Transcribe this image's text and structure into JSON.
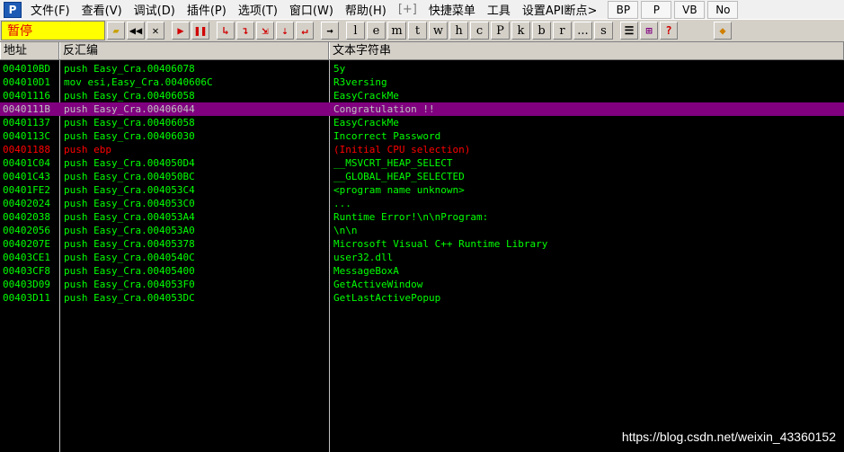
{
  "menubar": {
    "app_icon": "P",
    "items": [
      "文件(F)",
      "查看(V)",
      "调试(D)",
      "插件(P)",
      "选项(T)",
      "窗口(W)",
      "帮助(H)",
      "[+]",
      "快捷菜单",
      "工具",
      "设置API断点>"
    ],
    "tabs": [
      "BP",
      "P",
      "VB",
      "No"
    ]
  },
  "toolbar": {
    "status": "暂停",
    "letters": [
      "l",
      "e",
      "m",
      "t",
      "w",
      "h",
      "c",
      "P",
      "k",
      "b",
      "r",
      "...",
      "s"
    ],
    "icons": [
      "open-icon",
      "rewind-icon",
      "close-icon",
      "run-icon",
      "pause-icon",
      "step-into-icon",
      "step-over-icon",
      "trace-into-icon",
      "trace-over-icon",
      "execute-till-return-icon",
      "go-to-icon",
      "list-icon",
      "grid-icon",
      "help-icon",
      "plugin-icon"
    ]
  },
  "columns": {
    "addr": "地址",
    "disasm": "反汇编",
    "text": "文本字符串"
  },
  "rows": [
    {
      "addr": "004010BD",
      "disasm": "push Easy_Cra.00406078",
      "text": "5y"
    },
    {
      "addr": "004010D1",
      "disasm": "mov esi,Easy_Cra.0040606C",
      "text": "R3versing"
    },
    {
      "addr": "00401116",
      "disasm": "push Easy_Cra.00406058",
      "text": "EasyCrackMe"
    },
    {
      "addr": "0040111B",
      "disasm": "push Easy_Cra.00406044",
      "text": "Congratulation !!",
      "style": "sel"
    },
    {
      "addr": "00401137",
      "disasm": "push Easy_Cra.00406058",
      "text": "EasyCrackMe"
    },
    {
      "addr": "0040113C",
      "disasm": "push Easy_Cra.00406030",
      "text": "Incorrect Password"
    },
    {
      "addr": "00401188",
      "disasm": "push ebp",
      "text": "(Initial CPU selection)",
      "style": "red"
    },
    {
      "addr": "00401C04",
      "disasm": "push Easy_Cra.004050D4",
      "text": "__MSVCRT_HEAP_SELECT"
    },
    {
      "addr": "00401C43",
      "disasm": "push Easy_Cra.004050BC",
      "text": "__GLOBAL_HEAP_SELECTED"
    },
    {
      "addr": "00401FE2",
      "disasm": "push Easy_Cra.004053C4",
      "text": "<program name unknown>"
    },
    {
      "addr": "00402024",
      "disasm": "push Easy_Cra.004053C0",
      "text": "..."
    },
    {
      "addr": "00402038",
      "disasm": "push Easy_Cra.004053A4",
      "text": "Runtime Error!\\n\\nProgram: "
    },
    {
      "addr": "00402056",
      "disasm": "push Easy_Cra.004053A0",
      "text": "\\n\\n"
    },
    {
      "addr": "0040207E",
      "disasm": "push Easy_Cra.00405378",
      "text": "Microsoft Visual C++ Runtime Library"
    },
    {
      "addr": "00403CE1",
      "disasm": "push Easy_Cra.0040540C",
      "text": "user32.dll"
    },
    {
      "addr": "00403CF8",
      "disasm": "push Easy_Cra.00405400",
      "text": "MessageBoxA"
    },
    {
      "addr": "00403D09",
      "disasm": "push Easy_Cra.004053F0",
      "text": "GetActiveWindow"
    },
    {
      "addr": "00403D11",
      "disasm": "push Easy_Cra.004053DC",
      "text": "GetLastActivePopup"
    }
  ],
  "watermark": "https://blog.csdn.net/weixin_43360152",
  "colors": {
    "text": "#00ff00",
    "selection": "#800080",
    "highlight_red": "#ff0000",
    "status_bg": "#ffff00"
  }
}
